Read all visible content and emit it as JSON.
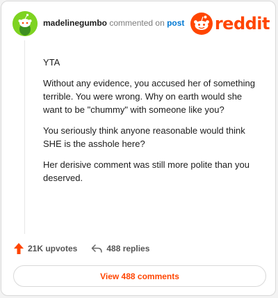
{
  "comment": {
    "username": "madelinegumbo",
    "commented_on": "commented on",
    "post_link": "post",
    "avatar_icon": "snoo-avatar-icon",
    "paragraphs": [
      "YTA",
      "Without any evidence, you accused her of something terrible. You were wrong. Why on earth would she want to be \"chummy\" with someone like you?",
      "You seriously think anyone reasonable would think SHE is the asshole here?",
      "Her derisive comment was still more polite than you deserved."
    ]
  },
  "brand": {
    "wordmark": "reddit",
    "icon": "reddit-logo-icon",
    "color": "#ff4500"
  },
  "actions": {
    "upvotes": "21K upvotes",
    "replies": "488 replies",
    "upvote_icon": "upvote-arrow-icon",
    "reply_icon": "reply-arrow-icon"
  },
  "view_button": {
    "label": "View 488 comments"
  },
  "colors": {
    "accent": "#ff4500",
    "link": "#0079d3",
    "avatar_bg": "#7ed321"
  }
}
